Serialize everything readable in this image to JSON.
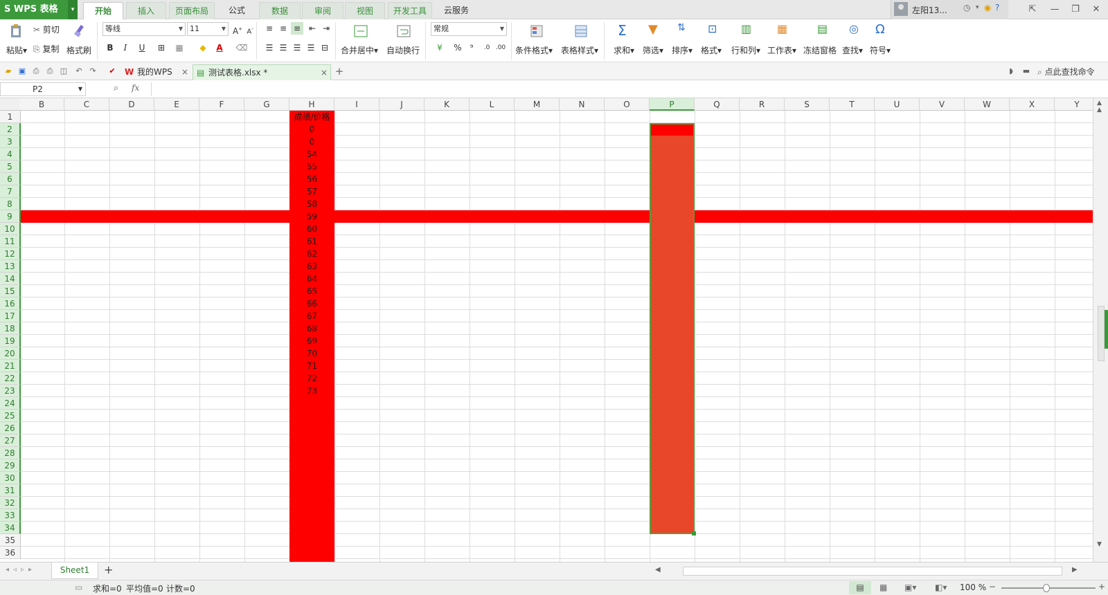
{
  "titlebar": {
    "app_name": "S WPS 表格",
    "menu_tabs": [
      {
        "label": "开始"
      },
      {
        "label": "插入"
      },
      {
        "label": "页面布局"
      },
      {
        "label": "公式"
      },
      {
        "label": "数据"
      },
      {
        "label": "审阅"
      },
      {
        "label": "视图"
      },
      {
        "label": "开发工具"
      },
      {
        "label": "云服务"
      }
    ],
    "user_name": "左阳13..."
  },
  "ribbon": {
    "paste_label": "粘贴",
    "cut_label": "剪切",
    "copy_label": "复制",
    "format_painter_label": "格式刷",
    "font_name": "等线",
    "font_size": "11",
    "bold": "B",
    "italic": "I",
    "underline": "U",
    "merge_center_label": "合并居中",
    "wrap_text_label": "自动换行",
    "number_format": "常规",
    "percent": "%",
    "comma": "⁹",
    "conditional_format_label": "条件格式",
    "table_style_label": "表格样式",
    "sum_label": "求和",
    "filter_label": "筛选",
    "sort_label": "排序",
    "format_label": "格式",
    "row_col_label": "行和列",
    "worksheet_label": "工作表",
    "freeze_label": "冻结窗格",
    "find_label": "查找",
    "symbol_label": "符号"
  },
  "qat": {
    "tabs": [
      {
        "label": "我的WPS"
      },
      {
        "label": "测试表格.xlsx *"
      }
    ],
    "search_command": "点此查找命令"
  },
  "formula_bar": {
    "name_box": "P2",
    "fx": "fx",
    "formula": ""
  },
  "grid": {
    "columns": [
      "B",
      "C",
      "D",
      "E",
      "F",
      "G",
      "H",
      "I",
      "J",
      "K",
      "L",
      "M",
      "N",
      "O",
      "P",
      "Q",
      "R",
      "S",
      "T",
      "U",
      "V",
      "W",
      "X",
      "Y"
    ],
    "rows": [
      "1",
      "2",
      "3",
      "4",
      "5",
      "6",
      "7",
      "8",
      "9",
      "10",
      "11",
      "12",
      "13",
      "14",
      "15",
      "16",
      "17",
      "18",
      "19",
      "20",
      "21",
      "22",
      "23",
      "24",
      "25",
      "26",
      "27",
      "28",
      "29",
      "30",
      "31",
      "32",
      "33",
      "34",
      "35",
      "36"
    ],
    "selected_column": "P",
    "highlight_row": "9",
    "highlight_color": "#ff0000",
    "selection_fill_color": "#e8472a",
    "column_h_values": [
      "成绩/价格",
      "0",
      "0",
      "54",
      "55",
      "56",
      "57",
      "58",
      "59",
      "60",
      "61",
      "62",
      "63",
      "64",
      "65",
      "66",
      "67",
      "68",
      "69",
      "70",
      "71",
      "72",
      "73"
    ]
  },
  "sheets": {
    "tabs": [
      {
        "label": "Sheet1"
      }
    ],
    "add": "+"
  },
  "status": {
    "sum": "求和=0",
    "average": "平均值=0",
    "count": "计数=0",
    "zoom": "100 %"
  },
  "colors": {
    "brand_green": "#3c9a3c",
    "highlight_red": "#ff0000"
  }
}
